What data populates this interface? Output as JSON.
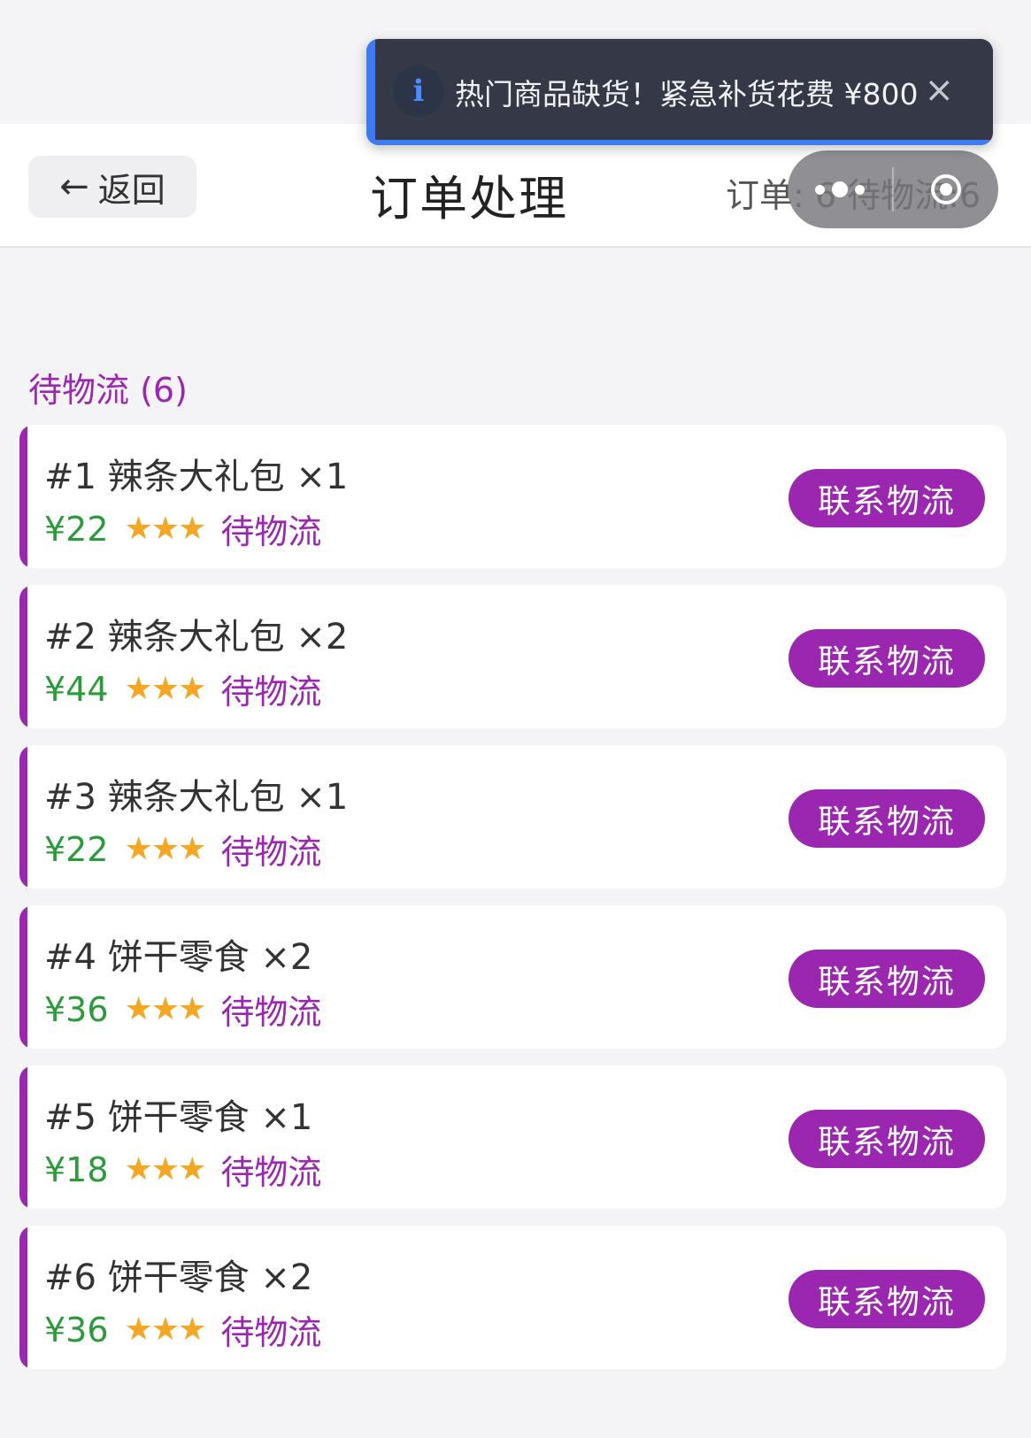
{
  "header": {
    "back_label": "返回",
    "back_arrow": "←",
    "title": "订单处理",
    "stats": "订单: 6 待物流:6"
  },
  "toast": {
    "icon": "info-icon",
    "message": "热门商品缺货！紧急补货花费 ¥800",
    "close": "×"
  },
  "section": {
    "title": "待物流 (6)"
  },
  "orders": [
    {
      "title": "#1 辣条大礼包 ×1",
      "price": "¥22",
      "stars": "★★★",
      "rating": 3,
      "status": "待物流",
      "action": "联系物流"
    },
    {
      "title": "#2 辣条大礼包 ×2",
      "price": "¥44",
      "stars": "★★★",
      "rating": 3,
      "status": "待物流",
      "action": "联系物流"
    },
    {
      "title": "#3 辣条大礼包 ×1",
      "price": "¥22",
      "stars": "★★★",
      "rating": 3,
      "status": "待物流",
      "action": "联系物流"
    },
    {
      "title": "#4 饼干零食 ×2",
      "price": "¥36",
      "stars": "★★★",
      "rating": 3,
      "status": "待物流",
      "action": "联系物流"
    },
    {
      "title": "#5 饼干零食 ×1",
      "price": "¥18",
      "stars": "★★★",
      "rating": 3,
      "status": "待物流",
      "action": "联系物流"
    },
    {
      "title": "#6 饼干零食 ×2",
      "price": "¥36",
      "stars": "★★★",
      "rating": 3,
      "status": "待物流",
      "action": "联系物流"
    }
  ],
  "colors": {
    "accent": "#9b27b0",
    "price": "#2b9a3a",
    "star": "#f5a623",
    "toast_bg": "#343847",
    "toast_accent": "#3f7bf0"
  }
}
